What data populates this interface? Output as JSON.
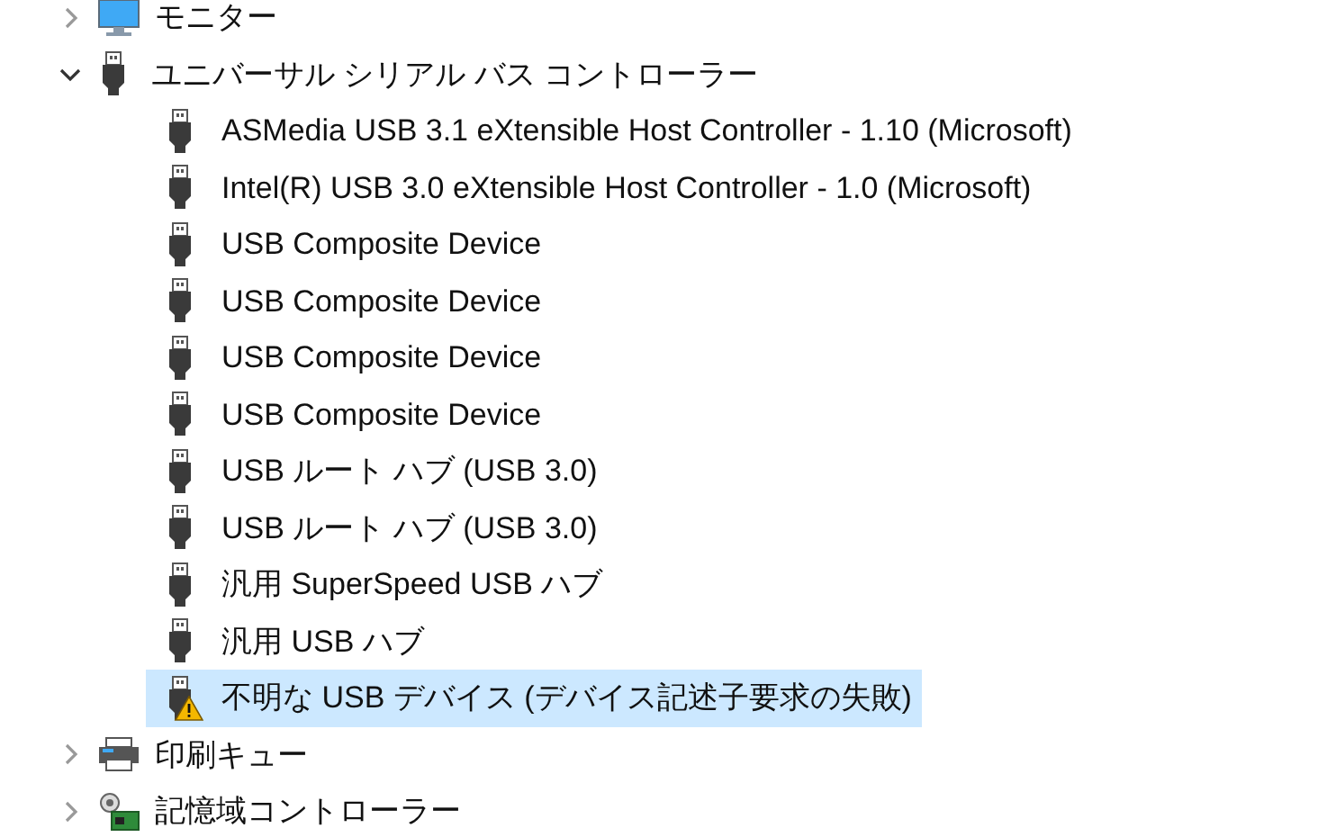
{
  "tree": [
    {
      "label": "モニター",
      "kind": "monitor",
      "expanded": false,
      "selected": false
    },
    {
      "label": "ユニバーサル シリアル バス コントローラー",
      "kind": "usb",
      "expanded": true,
      "selected": false,
      "children": [
        {
          "label": "ASMedia USB 3.1 eXtensible Host Controller - 1.10 (Microsoft)",
          "kind": "usb",
          "selected": false,
          "warning": false
        },
        {
          "label": "Intel(R) USB 3.0 eXtensible Host Controller - 1.0 (Microsoft)",
          "kind": "usb",
          "selected": false,
          "warning": false
        },
        {
          "label": "USB Composite Device",
          "kind": "usb",
          "selected": false,
          "warning": false
        },
        {
          "label": "USB Composite Device",
          "kind": "usb",
          "selected": false,
          "warning": false
        },
        {
          "label": "USB Composite Device",
          "kind": "usb",
          "selected": false,
          "warning": false
        },
        {
          "label": "USB Composite Device",
          "kind": "usb",
          "selected": false,
          "warning": false
        },
        {
          "label": "USB ルート ハブ (USB 3.0)",
          "kind": "usb",
          "selected": false,
          "warning": false
        },
        {
          "label": "USB ルート ハブ (USB 3.0)",
          "kind": "usb",
          "selected": false,
          "warning": false
        },
        {
          "label": "汎用 SuperSpeed USB ハブ",
          "kind": "usb",
          "selected": false,
          "warning": false
        },
        {
          "label": "汎用 USB ハブ",
          "kind": "usb",
          "selected": false,
          "warning": false
        },
        {
          "label": "不明な USB デバイス (デバイス記述子要求の失敗)",
          "kind": "usb",
          "selected": true,
          "warning": true
        }
      ]
    },
    {
      "label": "印刷キュー",
      "kind": "printer",
      "expanded": false,
      "selected": false
    },
    {
      "label": "記憶域コントローラー",
      "kind": "storage",
      "expanded": false,
      "selected": false
    }
  ]
}
